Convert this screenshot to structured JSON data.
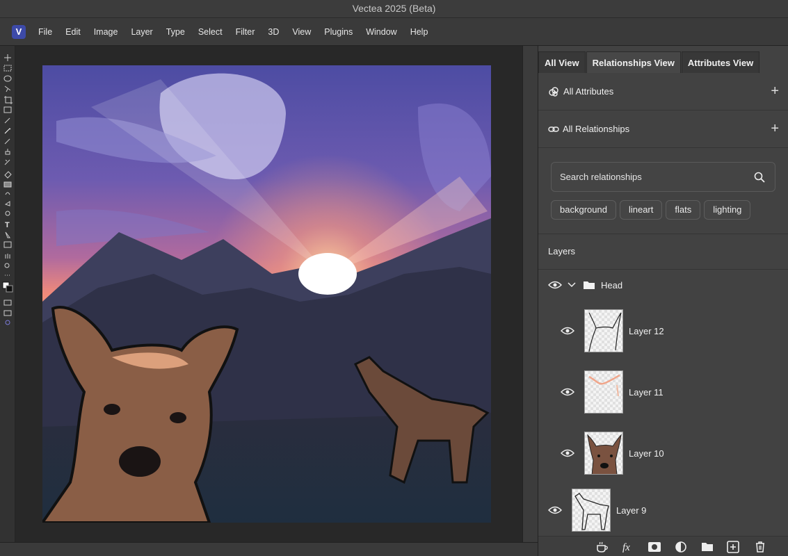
{
  "window": {
    "title": "Vectea 2025 (Beta)",
    "logo_letter": "V"
  },
  "menu": {
    "items": [
      "File",
      "Edit",
      "Image",
      "Layer",
      "Type",
      "Select",
      "Filter",
      "3D",
      "View",
      "Plugins",
      "Window",
      "Help"
    ]
  },
  "panel": {
    "tabs": [
      "All View",
      "Relationships View",
      "Attributes View"
    ],
    "active_tab": "Relationships View",
    "attributes_label": "All Attributes",
    "relationships_label": "All Relationships",
    "search_placeholder": "Search relationships",
    "chips": [
      "background",
      "lineart",
      "flats",
      "lighting"
    ],
    "layers_title": "Layers",
    "group_name": "Head",
    "layers": [
      {
        "name": "Layer 12"
      },
      {
        "name": "Layer 11"
      },
      {
        "name": "Layer 10"
      },
      {
        "name": "Layer 9"
      }
    ]
  },
  "footer_icons": [
    "cup-icon",
    "fx-icon",
    "mask-icon",
    "adjustment-icon",
    "folder-icon",
    "new-layer-icon",
    "trash-icon"
  ],
  "colors": {
    "accent": "#3d4aa8",
    "panel_bg": "#424242",
    "sky_top": "#4a4a9e",
    "sky_glow": "#f08a7a"
  }
}
